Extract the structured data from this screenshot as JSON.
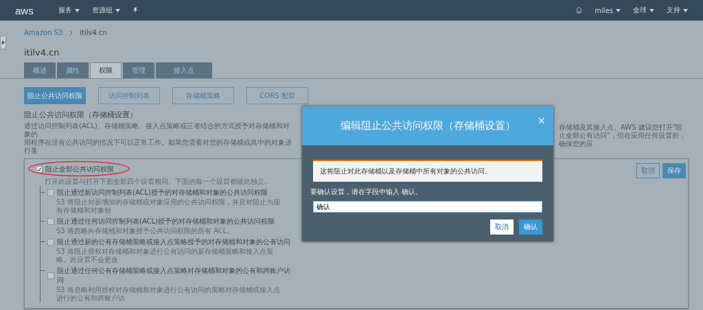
{
  "navbar": {
    "logo": "aws",
    "menus": [
      {
        "label": "服务"
      },
      {
        "label": "资源组"
      }
    ],
    "user": "miles",
    "region": "全球",
    "support": "支持"
  },
  "breadcrumb": [
    {
      "label": "Amazon S3",
      "link": true
    },
    {
      "label": "itilv4.cn",
      "link": false
    }
  ],
  "page_title": "itilv4.cn",
  "tabs": [
    {
      "label": "概述",
      "selected": false
    },
    {
      "label": "属性",
      "selected": false
    },
    {
      "label": "权限",
      "selected": true
    },
    {
      "label": "管理",
      "selected": false
    },
    {
      "label": "接入点",
      "selected": false
    }
  ],
  "subtabs": [
    {
      "label": "阻止公共访问权限",
      "selected": true
    },
    {
      "label": "访问控制列表",
      "selected": false
    },
    {
      "label": "存储桶策略",
      "selected": false
    },
    {
      "label": "CORS 配置",
      "selected": false
    }
  ],
  "section": {
    "heading": "阻止公共访问权限（存储桶设置）",
    "description_left": [
      "通过访问控制列表(ACL)、存储桶策略、接入点策略或三者结合的方式授予对存储桶和对象的",
      "用程序在没有公共访问的情况下可以正常工作。如果您需要对您的存储桶或其中的对象进行某"
    ],
    "description_right": "存储桶及其接入点。AWS 建议您打开\"阻止全部公有访问\"，但在应用任何设置前，确保您的应"
  },
  "settings": {
    "master": {
      "label": "阻止全部公共访问权限",
      "hint": "打开此设置与打开下面全部四个设置相同。下面的每一个设置都彼此独立。",
      "checked": true
    },
    "options": [
      {
        "label": "阻止通过新访问控制列表(ACL)授予的对存储桶和对象的公共访问权限",
        "hint": "S3 将阻止对新增加的存储桶或对象应用的公共访问权限，并且对阻止为现有存储桶和对象创",
        "checked": false
      },
      {
        "label": "阻止通过任何访问控制列表(ACL)授予的对存储桶和对象的公共访问权限",
        "hint": "S3 将忽略向存储桶和对象授予公共访问权限的所有 ACL。",
        "checked": false
      },
      {
        "label": "阻止通过新的公有存储桶策略或接入点策略授予的对存储桶和对象的公有访问",
        "hint": "S3 将阻止授权对存储桶和对象进行公有访问的新存储桶策略和接入点策略。此设置不会更改",
        "checked": false
      },
      {
        "label": "阻止通过任何公有存储桶策略或接入点策略对存储桶和对象的公有和跨账户访问",
        "hint": "S3 将忽略利用授权对存储桶和对象进行公有访问的策略对存储桶或接入点进行的公有和跨账户访",
        "checked": false
      }
    ],
    "cancel": "取消",
    "save": "保存"
  },
  "modal": {
    "title": "编辑阻止公共访问权限（存储桶设置）",
    "close": "×",
    "alert": "这将阻止对此存储桶以及存储桶中所有对象的公共访问。",
    "prompt": "要确认设置，请在字段中输入 确认。",
    "value": "确认",
    "cancel": "取消",
    "confirm": "确认"
  }
}
